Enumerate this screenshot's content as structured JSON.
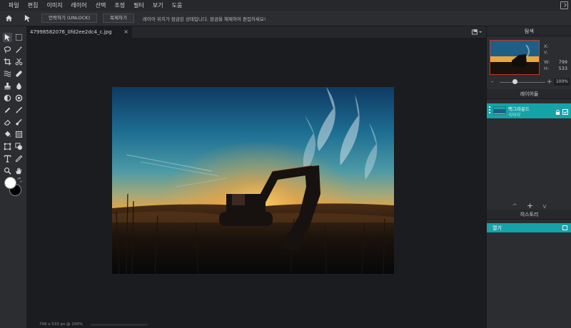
{
  "menu": {
    "items": [
      "파일",
      "편집",
      "이미지",
      "레이어",
      "선택",
      "조정",
      "필터",
      "보기",
      "도움"
    ]
  },
  "options": {
    "unlock_label": "언락하기 (UNLOCK)",
    "duplicate_label": "복제하기",
    "message": "레이어 위치가 잠금된 상태입니다. 잠금을 해제하여 편집하세요!"
  },
  "document": {
    "tab_title": "47998582076_0fd2ee2dc4_c.jpg",
    "tab_close": "×",
    "status": "799 x 533 px @ 100%"
  },
  "navigator": {
    "title": "탐색",
    "x_label": "X:",
    "y_label": "Y:",
    "w_label": "W:",
    "h_label": "H:",
    "x_value": "",
    "y_value": "",
    "w_value": "799",
    "h_value": "533",
    "zoom_minus": "-",
    "zoom_plus": "+",
    "zoom": "100%"
  },
  "layers": {
    "title": "레이어들",
    "items": [
      {
        "name": "백그라운드",
        "sub": "이미지"
      }
    ],
    "action_up": "^",
    "action_add": "+",
    "action_down": "v"
  },
  "history": {
    "title": "히스토리",
    "items": [
      "열기"
    ]
  },
  "colors": {
    "accent": "#16a3a8",
    "foreground": "#ffffff",
    "background": "#000000"
  }
}
